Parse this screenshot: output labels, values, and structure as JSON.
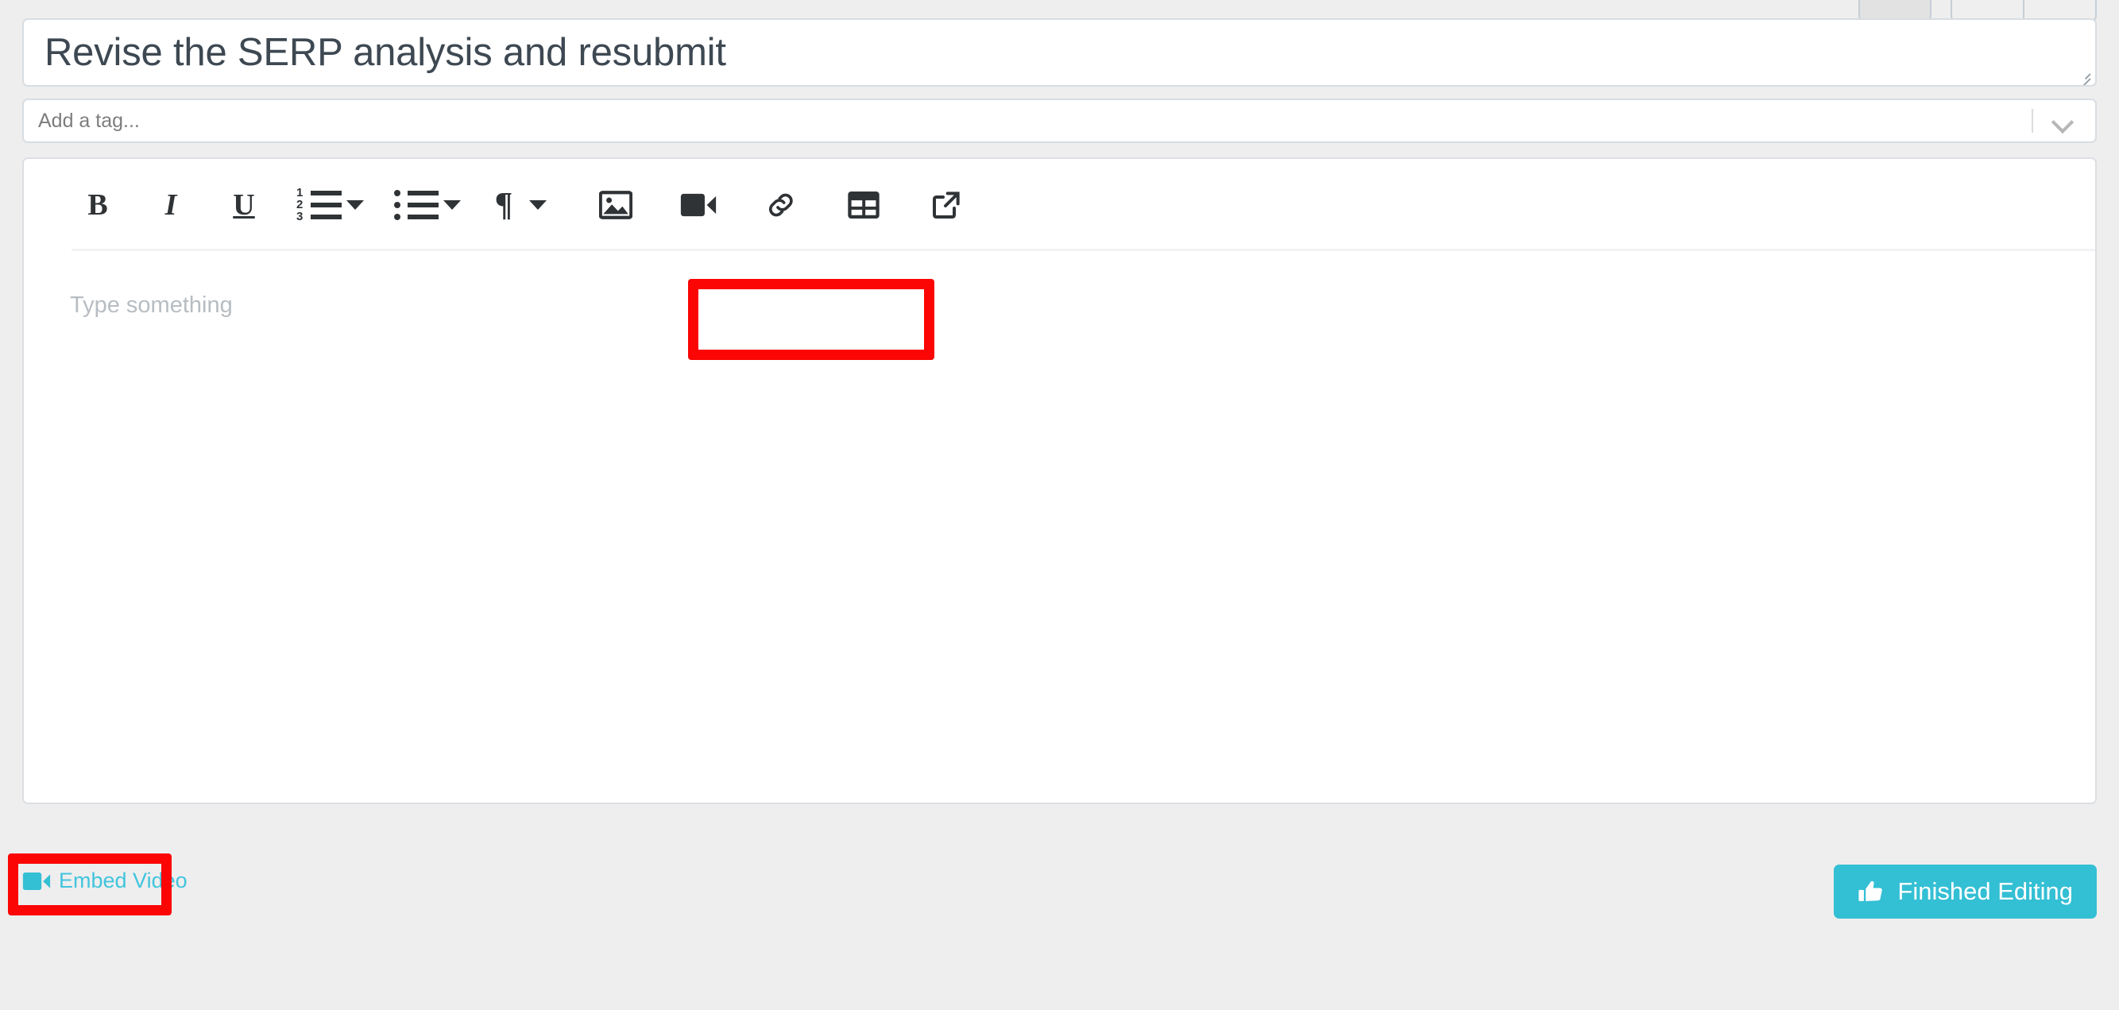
{
  "header": {
    "buttons": [
      {
        "name": "header-button-single",
        "label": ""
      },
      {
        "name": "header-button-group-left",
        "label": ""
      },
      {
        "name": "header-button-group-right",
        "label": ""
      }
    ]
  },
  "title_field": {
    "value": "Revise the SERP analysis and resubmit",
    "resize_handle": "resize-grip"
  },
  "tag_field": {
    "placeholder": "Add a tag...",
    "value": "",
    "dropdown_icon": "chevron-down-icon"
  },
  "editor": {
    "content_placeholder": "Type something",
    "content_value": "",
    "toolbar": [
      {
        "name": "bold-button",
        "icon": "bold-icon",
        "label": "B"
      },
      {
        "name": "italic-button",
        "icon": "italic-icon",
        "label": "I"
      },
      {
        "name": "underline-button",
        "icon": "underline-icon",
        "label": "U"
      },
      {
        "name": "ordered-list-button",
        "icon": "ordered-list-icon",
        "label": ""
      },
      {
        "name": "ordered-list-dropdown",
        "icon": "caret-down-icon",
        "label": ""
      },
      {
        "name": "bullet-list-button",
        "icon": "bullet-list-icon",
        "label": ""
      },
      {
        "name": "bullet-list-dropdown",
        "icon": "caret-down-icon",
        "label": ""
      },
      {
        "name": "paragraph-button",
        "icon": "pilcrow-icon",
        "label": "¶"
      },
      {
        "name": "paragraph-dropdown",
        "icon": "caret-down-icon",
        "label": ""
      },
      {
        "name": "insert-image-button",
        "icon": "image-icon",
        "label": ""
      },
      {
        "name": "insert-video-button",
        "icon": "video-camera-icon",
        "label": ""
      },
      {
        "name": "insert-link-button",
        "icon": "link-chain-icon",
        "label": ""
      },
      {
        "name": "insert-table-button",
        "icon": "table-grid-icon",
        "label": ""
      },
      {
        "name": "external-link-button",
        "icon": "external-link-icon",
        "label": ""
      }
    ]
  },
  "footer": {
    "embed_video_label": "Embed Video",
    "embed_video_icon": "video-camera-icon",
    "finish_label": "Finished Editing",
    "finish_icon": "thumbs-up-icon"
  },
  "annotations": [
    {
      "name": "media-buttons-highlight",
      "color": "#fb0505"
    },
    {
      "name": "embed-video-highlight",
      "color": "#fb0505"
    }
  ],
  "colors": {
    "accent_cyan": "#33bfd4",
    "link_cyan": "#41c4dd",
    "annotation_red": "#fb0505",
    "page_bg": "#eeeeee",
    "panel_bg": "#ffffff",
    "border": "#d8dde2",
    "text_dark": "#3d4852",
    "placeholder": "#b7bdc2"
  }
}
